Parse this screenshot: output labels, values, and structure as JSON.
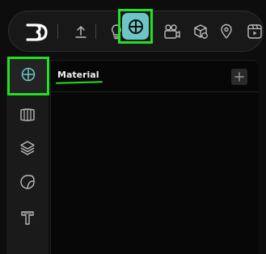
{
  "toolbar": {
    "items": [
      {
        "name": "logo",
        "icon": "3d-logo-icon"
      },
      {
        "name": "upload",
        "icon": "upload-icon"
      },
      {
        "name": "light",
        "icon": "bulb-icon"
      },
      {
        "name": "material",
        "icon": "crosshair-circle-icon",
        "active": true
      },
      {
        "name": "camera",
        "icon": "video-camera-icon"
      },
      {
        "name": "object",
        "icon": "box-gear-icon"
      },
      {
        "name": "location",
        "icon": "map-pin-icon"
      },
      {
        "name": "video",
        "icon": "film-icon"
      }
    ]
  },
  "sidebar": {
    "items": [
      {
        "name": "material",
        "icon": "crosshair-circle-icon",
        "active": true
      },
      {
        "name": "texture",
        "icon": "texture-strip-icon"
      },
      {
        "name": "layers",
        "icon": "layers-icon"
      },
      {
        "name": "decal",
        "icon": "sticker-icon"
      },
      {
        "name": "text",
        "icon": "text-t-icon"
      }
    ]
  },
  "panel": {
    "title": "Material",
    "add_label": "+"
  },
  "colors": {
    "highlight": "#22e022",
    "accent": "#6dc5c5",
    "background": "#0d0d0d"
  }
}
